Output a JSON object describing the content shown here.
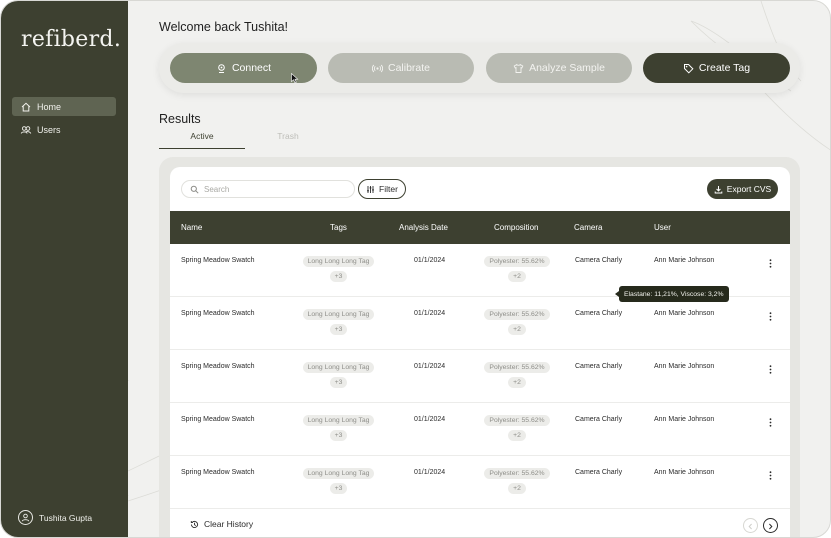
{
  "app": {
    "logo": "refiberd."
  },
  "sidebar": {
    "items": [
      {
        "label": "Home",
        "icon": "home-icon",
        "active": true
      },
      {
        "label": "Users",
        "icon": "users-icon",
        "active": false
      }
    ],
    "user": {
      "name": "Tushita Gupta",
      "icon": "user-circle-icon"
    }
  },
  "header": {
    "welcome": "Welcome back Tushita!"
  },
  "actions": {
    "connect": "Connect",
    "calibrate": "Calibrate",
    "analyze": "Analyze Sample",
    "create_tag": "Create Tag"
  },
  "results": {
    "title": "Results",
    "tabs": [
      {
        "label": "Active",
        "active": true
      },
      {
        "label": "Trash",
        "active": false
      }
    ],
    "search_placeholder": "Search",
    "filter_label": "Filter",
    "export_label": "Export CVS",
    "columns": [
      "Name",
      "Tags",
      "Analysis Date",
      "Composition",
      "Camera",
      "User"
    ],
    "rows": [
      {
        "name": "Spring Meadow Swatch",
        "tag": "Long Long Long Tag",
        "tag_more": "+3",
        "date": "01/1/2024",
        "composition": "Polyester: 55.62%",
        "comp_more": "+2",
        "camera": "Camera Charly",
        "user": "Ann Marie Johnson"
      },
      {
        "name": "Spring Meadow Swatch",
        "tag": "Long Long Long Tag",
        "tag_more": "+3",
        "date": "01/1/2024",
        "composition": "Polyester: 55.62%",
        "comp_more": "+2",
        "camera": "Camera Charly",
        "user": "Ann Marie Johnson"
      },
      {
        "name": "Spring Meadow Swatch",
        "tag": "Long Long Long Tag",
        "tag_more": "+3",
        "date": "01/1/2024",
        "composition": "Polyester: 55.62%",
        "comp_more": "+2",
        "camera": "Camera Charly",
        "user": "Ann Marie Johnson"
      },
      {
        "name": "Spring Meadow Swatch",
        "tag": "Long Long Long Tag",
        "tag_more": "+3",
        "date": "01/1/2024",
        "composition": "Polyester: 55.62%",
        "comp_more": "+2",
        "camera": "Camera Charly",
        "user": "Ann Marie Johnson"
      },
      {
        "name": "Spring Meadow Swatch",
        "tag": "Long Long Long Tag",
        "tag_more": "+3",
        "date": "01/1/2024",
        "composition": "Polyester: 55.62%",
        "comp_more": "+2",
        "camera": "Camera Charly",
        "user": "Ann Marie Johnson"
      }
    ],
    "tooltip": "Elastane: 11,21%, Viscose: 3,2%",
    "clear_history": "Clear History"
  },
  "colors": {
    "sidebar": "#3d4030",
    "accent_dark": "#3d4030",
    "connect": "#7e8671",
    "disabled": "#b9bbb3",
    "background": "#f1f1ef"
  }
}
